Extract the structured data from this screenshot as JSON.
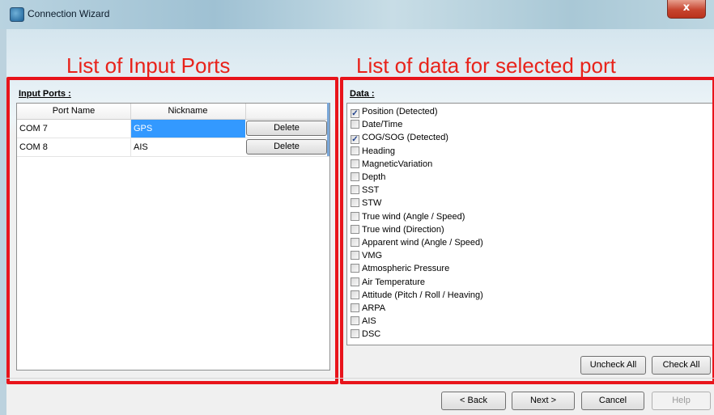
{
  "window": {
    "title": "Connection Wizard",
    "close_label": "x"
  },
  "annotations": {
    "left_title": "List of Input Ports",
    "right_title": "List of data for selected port",
    "color": "#e8141b"
  },
  "input_ports": {
    "label": "Input Ports :",
    "columns": [
      "Port Name",
      "Nickname",
      ""
    ],
    "rows": [
      {
        "port": "COM 7",
        "nickname": "GPS",
        "selected": true,
        "action": "Delete"
      },
      {
        "port": "COM 8",
        "nickname": "AIS",
        "selected": false,
        "action": "Delete"
      }
    ]
  },
  "data": {
    "label": "Data :",
    "items": [
      {
        "label": "Position (Detected)",
        "checked": true
      },
      {
        "label": "Date/Time",
        "checked": false
      },
      {
        "label": "COG/SOG (Detected)",
        "checked": true
      },
      {
        "label": "Heading",
        "checked": false
      },
      {
        "label": "MagneticVariation",
        "checked": false
      },
      {
        "label": "Depth",
        "checked": false
      },
      {
        "label": "SST",
        "checked": false
      },
      {
        "label": "STW",
        "checked": false
      },
      {
        "label": "True wind (Angle / Speed)",
        "checked": false
      },
      {
        "label": "True wind (Direction)",
        "checked": false
      },
      {
        "label": "Apparent wind (Angle / Speed)",
        "checked": false
      },
      {
        "label": "VMG",
        "checked": false
      },
      {
        "label": "Atmospheric Pressure",
        "checked": false
      },
      {
        "label": "Air Temperature",
        "checked": false
      },
      {
        "label": "Attitude (Pitch / Roll / Heaving)",
        "checked": false
      },
      {
        "label": "ARPA",
        "checked": false
      },
      {
        "label": "AIS",
        "checked": false
      },
      {
        "label": "DSC",
        "checked": false
      }
    ],
    "uncheck_all": "Uncheck All",
    "check_all": "Check All"
  },
  "footer": {
    "back": "< Back",
    "next": "Next >",
    "cancel": "Cancel",
    "help": "Help"
  }
}
